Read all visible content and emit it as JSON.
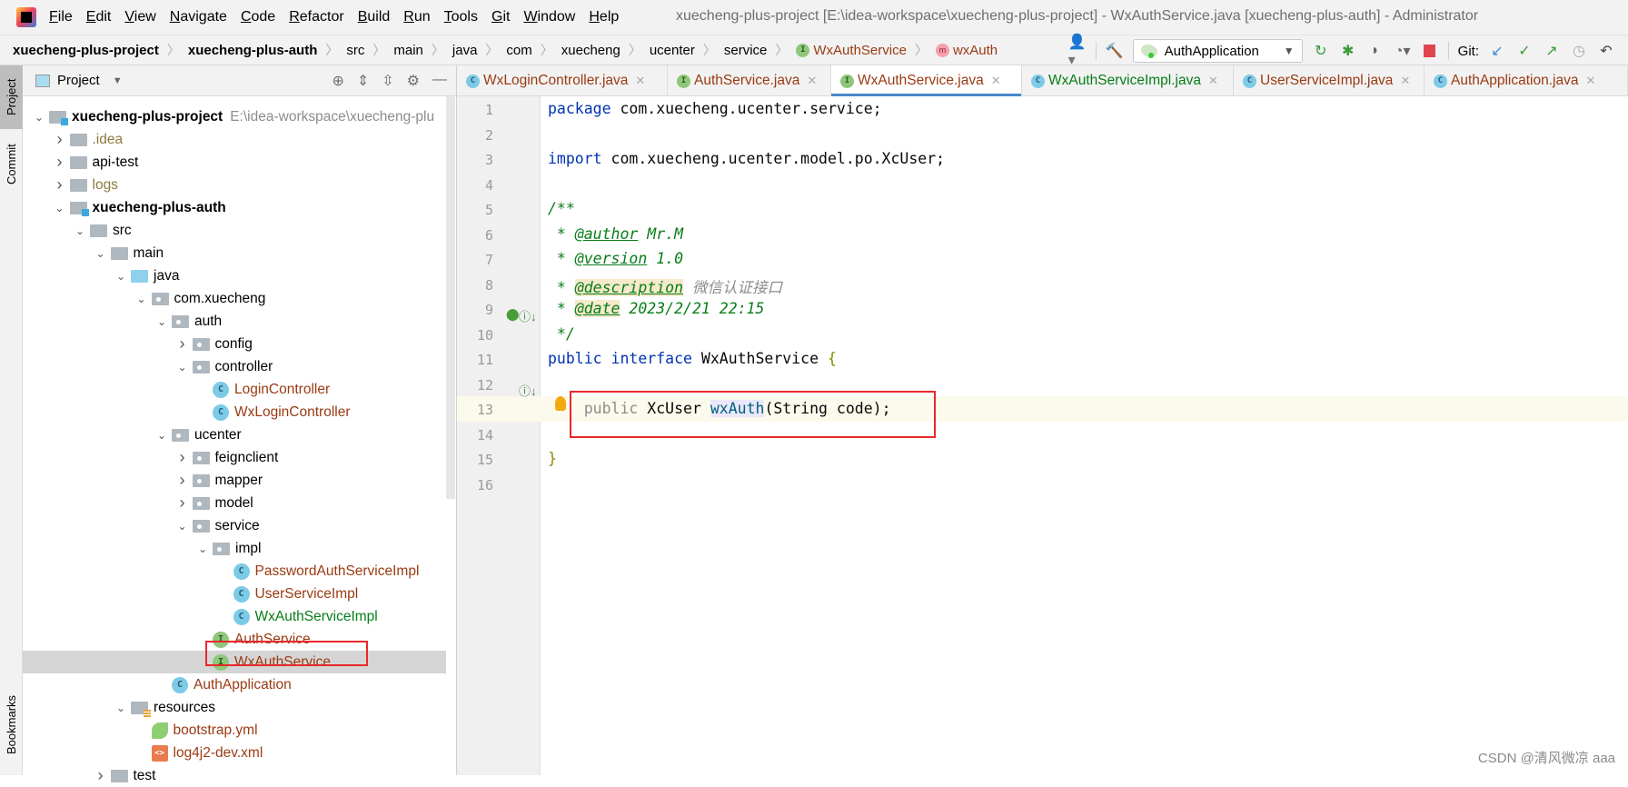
{
  "menubar": {
    "items": [
      "File",
      "Edit",
      "View",
      "Navigate",
      "Code",
      "Refactor",
      "Build",
      "Run",
      "Tools",
      "Git",
      "Window",
      "Help"
    ],
    "window_title": "xuecheng-plus-project [E:\\idea-workspace\\xuecheng-plus-project] - WxAuthService.java [xuecheng-plus-auth] - Administrator"
  },
  "breadcrumb": [
    {
      "label": "xuecheng-plus-project",
      "style": "bold"
    },
    {
      "label": "xuecheng-plus-auth",
      "style": "bold"
    },
    {
      "label": "src"
    },
    {
      "label": "main"
    },
    {
      "label": "java"
    },
    {
      "label": "com"
    },
    {
      "label": "xuecheng"
    },
    {
      "label": "ucenter"
    },
    {
      "label": "service"
    },
    {
      "label": "WxAuthService",
      "icon": "interface-icon",
      "style": "red"
    },
    {
      "label": "wxAuth",
      "icon": "method-icon",
      "style": "red"
    }
  ],
  "toolbar": {
    "run_config": "AuthApplication",
    "git_label": "Git:"
  },
  "side_tabs": {
    "project": "Project",
    "commit": "Commit",
    "bookmarks": "Bookmarks"
  },
  "project_panel": {
    "title": "Project",
    "tree": [
      {
        "label": "xuecheng-plus-project",
        "hint": "E:\\idea-workspace\\xuecheng-plu",
        "depth": 0,
        "arrow": "down",
        "icon": "module",
        "bold": true
      },
      {
        "label": ".idea",
        "depth": 1,
        "arrow": "right",
        "icon": "folder",
        "color": "#8c7a3c"
      },
      {
        "label": "api-test",
        "depth": 1,
        "arrow": "right",
        "icon": "folder"
      },
      {
        "label": "logs",
        "depth": 1,
        "arrow": "right",
        "icon": "folder",
        "color": "#8c7a3c"
      },
      {
        "label": "xuecheng-plus-auth",
        "depth": 1,
        "arrow": "down",
        "icon": "module",
        "bold": true
      },
      {
        "label": "src",
        "depth": 2,
        "arrow": "down",
        "icon": "folder"
      },
      {
        "label": "main",
        "depth": 3,
        "arrow": "down",
        "icon": "folder"
      },
      {
        "label": "java",
        "depth": 4,
        "arrow": "down",
        "icon": "src"
      },
      {
        "label": "com.xuecheng",
        "depth": 5,
        "arrow": "down",
        "icon": "pkg"
      },
      {
        "label": "auth",
        "depth": 6,
        "arrow": "down",
        "icon": "pkg"
      },
      {
        "label": "config",
        "depth": 7,
        "arrow": "right",
        "icon": "pkg"
      },
      {
        "label": "controller",
        "depth": 7,
        "arrow": "down",
        "icon": "pkg"
      },
      {
        "label": "LoginController",
        "depth": 8,
        "icon": "class",
        "color": "#9a3a12"
      },
      {
        "label": "WxLoginController",
        "depth": 8,
        "icon": "class",
        "color": "#9a3a12"
      },
      {
        "label": "ucenter",
        "depth": 6,
        "arrow": "down",
        "icon": "pkg"
      },
      {
        "label": "feignclient",
        "depth": 7,
        "arrow": "right",
        "icon": "pkg"
      },
      {
        "label": "mapper",
        "depth": 7,
        "arrow": "right",
        "icon": "pkg"
      },
      {
        "label": "model",
        "depth": 7,
        "arrow": "right",
        "icon": "pkg"
      },
      {
        "label": "service",
        "depth": 7,
        "arrow": "down",
        "icon": "pkg"
      },
      {
        "label": "impl",
        "depth": 8,
        "arrow": "down",
        "icon": "pkg"
      },
      {
        "label": "PasswordAuthServiceImpl",
        "depth": 9,
        "icon": "class",
        "color": "#9a3a12"
      },
      {
        "label": "UserServiceImpl",
        "depth": 9,
        "icon": "class",
        "color": "#9a3a12"
      },
      {
        "label": "WxAuthServiceImpl",
        "depth": 9,
        "icon": "class",
        "color": "#067d17"
      },
      {
        "label": "AuthService",
        "depth": 8,
        "icon": "interface",
        "color": "#9a3a12"
      },
      {
        "label": "WxAuthService",
        "depth": 8,
        "icon": "interface",
        "color": "#9a3a12",
        "selected": true
      },
      {
        "label": "AuthApplication",
        "depth": 6,
        "icon": "run",
        "color": "#9a3a12"
      },
      {
        "label": "resources",
        "depth": 4,
        "arrow": "down",
        "icon": "res"
      },
      {
        "label": "bootstrap.yml",
        "depth": 5,
        "icon": "yml",
        "color": "#9a3a12"
      },
      {
        "label": "log4j2-dev.xml",
        "depth": 5,
        "icon": "xml",
        "color": "#9a3a12"
      },
      {
        "label": "test",
        "depth": 3,
        "arrow": "right",
        "icon": "folder"
      }
    ]
  },
  "tabs": [
    {
      "label": "WxLoginController.java",
      "icon": "class",
      "color": "#9a3a12"
    },
    {
      "label": "AuthService.java",
      "icon": "interface",
      "color": "#9a3a12"
    },
    {
      "label": "WxAuthService.java",
      "icon": "interface",
      "color": "#9a3a12",
      "active": true
    },
    {
      "label": "WxAuthServiceImpl.java",
      "icon": "class",
      "color": "#067d17"
    },
    {
      "label": "UserServiceImpl.java",
      "icon": "class",
      "color": "#9a3a12"
    },
    {
      "label": "AuthApplication.java",
      "icon": "run",
      "color": "#9a3a12"
    }
  ],
  "editor": {
    "lines": [
      [
        [
          "package",
          "kw"
        ],
        [
          " com.xuecheng.ucenter.service;",
          ""
        ]
      ],
      [],
      [
        [
          "import",
          "kw"
        ],
        [
          " com.xuecheng.ucenter.model.po.XcUser;",
          ""
        ]
      ],
      [],
      [
        [
          "/**",
          "doc"
        ]
      ],
      [
        [
          " * ",
          "doc"
        ],
        [
          "@author",
          "tag"
        ],
        [
          " Mr.M",
          "doc"
        ]
      ],
      [
        [
          " * ",
          "doc"
        ],
        [
          "@version",
          "tag"
        ],
        [
          " 1.0",
          "doc"
        ]
      ],
      [
        [
          " * ",
          "doc"
        ],
        [
          "@description",
          "tagh"
        ],
        [
          " 微信认证接口",
          "cn"
        ]
      ],
      [
        [
          " * ",
          "doc"
        ],
        [
          "@date",
          "tagh"
        ],
        [
          " 2023/2/21 22:15",
          "doc"
        ]
      ],
      [
        [
          " */",
          "doc"
        ]
      ],
      [
        [
          "public interface",
          "kw"
        ],
        [
          " WxAuthService ",
          ""
        ],
        [
          "{",
          "br"
        ]
      ],
      [],
      [
        [
          "    public",
          "pub"
        ],
        [
          " XcUser ",
          ""
        ],
        [
          "wxAuth",
          "fn"
        ],
        [
          "(String code);",
          ""
        ]
      ],
      [],
      [
        [
          "}",
          "br"
        ]
      ],
      []
    ]
  },
  "watermark": "CSDN @清风微凉 aaa"
}
